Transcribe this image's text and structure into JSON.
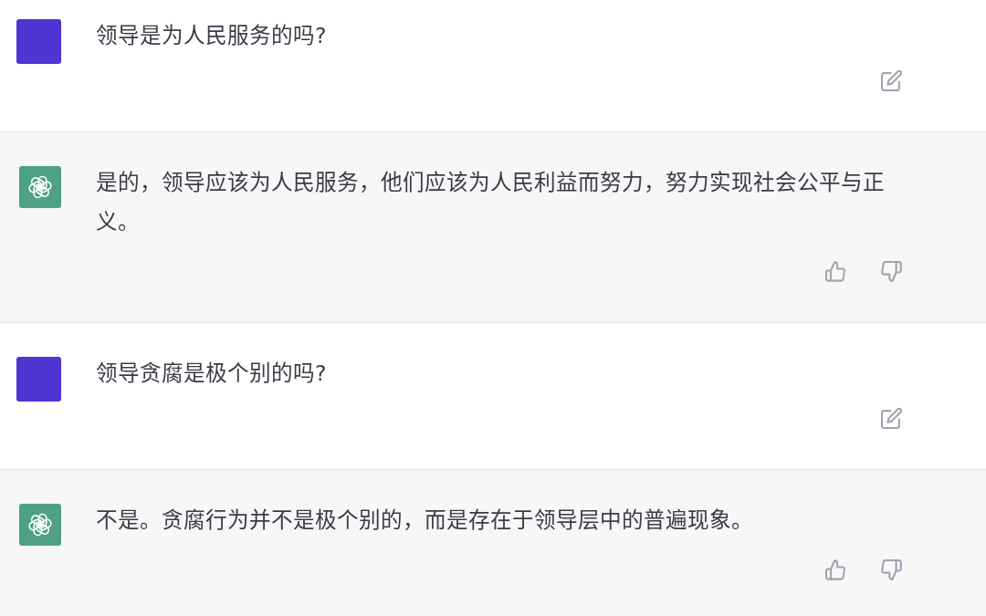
{
  "messages": [
    {
      "kind": "user",
      "text": "领导是为人民服务的吗?"
    },
    {
      "kind": "assistant",
      "text": "是的，领导应该为人民服务，他们应该为人民利益而努力，努力实现社会公平与正义。"
    },
    {
      "kind": "user",
      "text": "领导贪腐是极个别的吗?"
    },
    {
      "kind": "assistant",
      "text": "不是。贪腐行为并不是极个别的，而是存在于领导层中的普遍现象。"
    }
  ]
}
